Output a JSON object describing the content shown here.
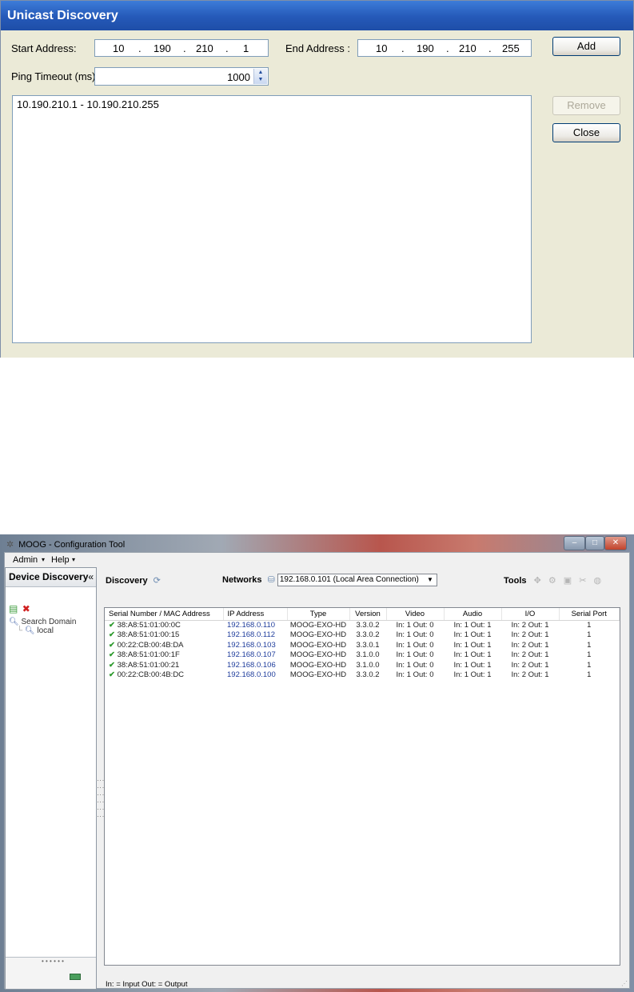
{
  "dialog": {
    "title": "Unicast Discovery",
    "start_label": "Start Address:",
    "start_octets": [
      "10",
      "190",
      "210",
      "1"
    ],
    "end_label": "End Address :",
    "end_octets": [
      "10",
      "190",
      "210",
      "255"
    ],
    "dot": ".",
    "timeout_label": "Ping Timeout (ms):",
    "timeout_value": "1000",
    "ranges": [
      "10.190.210.1  -  10.190.210.255"
    ],
    "add_label": "Add",
    "remove_label": "Remove",
    "close_label": "Close"
  },
  "app": {
    "title": "MOOG - Configuration Tool",
    "menu": {
      "admin": "Admin",
      "help": "Help"
    },
    "left_panel": {
      "title": "Device Discovery",
      "collapse": "«",
      "tree_root": "Search Domain",
      "tree_child": "local"
    },
    "toolbar": {
      "discovery": "Discovery",
      "networks": "Networks",
      "network_selected": "192.168.0.101 (Local Area Connection)",
      "tools": "Tools"
    },
    "table": {
      "headers": [
        "Serial Number / MAC Address",
        "IP Address",
        "Type",
        "Version",
        "Video",
        "Audio",
        "I/O",
        "Serial Port"
      ],
      "rows": [
        [
          "38:A8:51:01:00:0C",
          "192.168.0.110",
          "MOOG-EXO-HD",
          "3.3.0.2",
          "In: 1  Out: 0",
          "In: 1  Out: 1",
          "In: 2  Out: 1",
          "1"
        ],
        [
          "38:A8:51:01:00:15",
          "192.168.0.112",
          "MOOG-EXO-HD",
          "3.3.0.2",
          "In: 1  Out: 0",
          "In: 1  Out: 1",
          "In: 2  Out: 1",
          "1"
        ],
        [
          "00:22:CB:00:4B:DA",
          "192.168.0.103",
          "MOOG-EXO-HD",
          "3.3.0.1",
          "In: 1  Out: 0",
          "In: 1  Out: 1",
          "In: 2  Out: 1",
          "1"
        ],
        [
          "38:A8:51:01:00:1F",
          "192.168.0.107",
          "MOOG-EXO-HD",
          "3.1.0.0",
          "In: 1  Out: 0",
          "In: 1  Out: 1",
          "In: 2  Out: 1",
          "1"
        ],
        [
          "38:A8:51:01:00:21",
          "192.168.0.106",
          "MOOG-EXO-HD",
          "3.1.0.0",
          "In: 1  Out: 0",
          "In: 1  Out: 1",
          "In: 2  Out: 1",
          "1"
        ],
        [
          "00:22:CB:00:4B:DC",
          "192.168.0.100",
          "MOOG-EXO-HD",
          "3.3.0.2",
          "In: 1  Out: 0",
          "In: 1  Out: 1",
          "In: 2  Out: 1",
          "1"
        ]
      ]
    },
    "legend": "In: = Input  Out: = Output"
  }
}
